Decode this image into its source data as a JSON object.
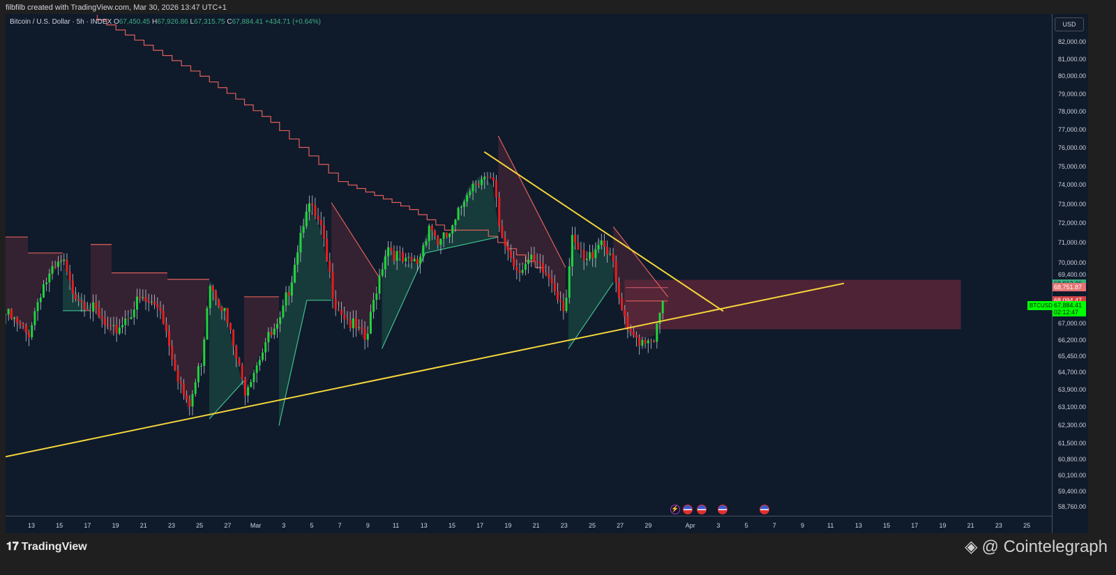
{
  "header": {
    "credit": "filbfilb created with TradingView.com, Mar 30, 2026 13:47 UTC+1"
  },
  "legend": {
    "symbol": "Bitcoin / U.S. Dollar · 5h · INDEX",
    "o_label": "O",
    "o": "67,450.45",
    "h_label": "H",
    "h": "67,926.86",
    "l_label": "L",
    "l": "67,315.75",
    "c_label": "C",
    "c": "67,884.41",
    "change": "+434.71 (+0.64%)"
  },
  "price_axis": {
    "currency": "USD",
    "ticks": [
      "82,000.00",
      "81,000.00",
      "80,000.00",
      "79,000.00",
      "78,000.00",
      "77,000.00",
      "76,000.00",
      "75,000.00",
      "74,000.00",
      "73,000.00",
      "72,000.00",
      "71,000.00",
      "70,000.00",
      "69,400.00",
      "67,000.00",
      "66,200.00",
      "65,450.00",
      "64,700.00",
      "63,900.00",
      "63,100.00",
      "62,300.00",
      "61,500.00",
      "60,800.00",
      "60,100.00",
      "59,400.00",
      "58,760.00"
    ],
    "labels": [
      {
        "text": "68,913.26",
        "value": 68913.26,
        "bg": "#3bb07f",
        "fg": "#0f1a2b"
      },
      {
        "text": "68,751.87",
        "value": 68751.87,
        "bg": "#e57373",
        "fg": "#ffffff"
      },
      {
        "text": "68,094.47",
        "value": 68094.47,
        "bg": "#cf4444",
        "fg": "#ffffff"
      }
    ],
    "last": {
      "symbol": "BTCUSD",
      "price": "67,884.41",
      "value": 67884.41,
      "countdown": "02:12:47",
      "bg": "#00ff00"
    }
  },
  "time_axis": {
    "ticks": [
      {
        "label": "13",
        "day": 0
      },
      {
        "label": "15",
        "day": 2
      },
      {
        "label": "17",
        "day": 4
      },
      {
        "label": "19",
        "day": 6
      },
      {
        "label": "21",
        "day": 8
      },
      {
        "label": "23",
        "day": 10
      },
      {
        "label": "25",
        "day": 12
      },
      {
        "label": "27",
        "day": 14
      },
      {
        "label": "Mar",
        "day": 16
      },
      {
        "label": "3",
        "day": 18
      },
      {
        "label": "5",
        "day": 20
      },
      {
        "label": "7",
        "day": 22
      },
      {
        "label": "9",
        "day": 24
      },
      {
        "label": "11",
        "day": 26
      },
      {
        "label": "13",
        "day": 28
      },
      {
        "label": "15",
        "day": 30
      },
      {
        "label": "17",
        "day": 32
      },
      {
        "label": "19",
        "day": 34
      },
      {
        "label": "21",
        "day": 36
      },
      {
        "label": "23",
        "day": 38
      },
      {
        "label": "25",
        "day": 40
      },
      {
        "label": "27",
        "day": 42
      },
      {
        "label": "29",
        "day": 44
      },
      {
        "label": "Apr",
        "day": 47
      },
      {
        "label": "3",
        "day": 49
      },
      {
        "label": "5",
        "day": 51
      },
      {
        "label": "7",
        "day": 53
      },
      {
        "label": "9",
        "day": 55
      },
      {
        "label": "11",
        "day": 57
      },
      {
        "label": "13",
        "day": 59
      },
      {
        "label": "15",
        "day": 61
      },
      {
        "label": "17",
        "day": 63
      },
      {
        "label": "19",
        "day": 65
      },
      {
        "label": "21",
        "day": 67
      },
      {
        "label": "23",
        "day": 69
      },
      {
        "label": "25",
        "day": 71
      }
    ]
  },
  "events": [
    {
      "icon": "flash-icon",
      "day": 45.9,
      "glyph": "⚡"
    },
    {
      "icon": "us-flag-icon",
      "day": 46.8
    },
    {
      "icon": "us-flag-icon",
      "day": 47.8
    },
    {
      "icon": "us-flag-icon",
      "day": 49.3
    },
    {
      "icon": "us-flag-icon",
      "day": 52.3
    }
  ],
  "footer": {
    "brand": "TradingView",
    "watermark": "@ Cointelegraph"
  },
  "colors": {
    "up": "#22d43a",
    "down": "#e61e1e",
    "bg": "#0f1a2b",
    "trendline": "#f5d63a",
    "supertrend_up": "#3fc28f",
    "supertrend_down": "#e0605a",
    "zone": "#7a2a3e"
  },
  "chart_data": {
    "type": "candlestick",
    "title": "Bitcoin / U.S. Dollar · 5h · INDEX",
    "x_unit": "days since Feb 13, 2026",
    "ylim": [
      58400,
      83600
    ],
    "y_scale": "log",
    "price_path": [
      [
        -1.8,
        67450
      ],
      [
        -0.25,
        66430
      ],
      [
        0.75,
        68820
      ],
      [
        2.24,
        70040
      ],
      [
        2.74,
        68820
      ],
      [
        4.23,
        67790
      ],
      [
        5.72,
        66430
      ],
      [
        7.71,
        68130
      ],
      [
        9.2,
        67790
      ],
      [
        10.2,
        65170
      ],
      [
        11.19,
        62880
      ],
      [
        12.19,
        65480
      ],
      [
        12.69,
        69160
      ],
      [
        13.68,
        67790
      ],
      [
        15.17,
        63870
      ],
      [
        16.67,
        66110
      ],
      [
        17.66,
        66770
      ],
      [
        18.41,
        68820
      ],
      [
        19.65,
        73070
      ],
      [
        20.65,
        71640
      ],
      [
        21.14,
        69750
      ],
      [
        21.64,
        68130
      ],
      [
        22.64,
        67100
      ],
      [
        23.88,
        66110
      ],
      [
        24.63,
        68820
      ],
      [
        25.37,
        70910
      ],
      [
        26.62,
        69890
      ],
      [
        27.61,
        70040
      ],
      [
        28.36,
        72000
      ],
      [
        29.1,
        70910
      ],
      [
        30.1,
        71640
      ],
      [
        31.09,
        73820
      ],
      [
        32.09,
        74540
      ],
      [
        33.08,
        73820
      ],
      [
        33.33,
        71640
      ],
      [
        34.58,
        69750
      ],
      [
        35.57,
        70040
      ],
      [
        37.06,
        69160
      ],
      [
        38.06,
        67790
      ],
      [
        38.56,
        71000
      ],
      [
        39.55,
        69890
      ],
      [
        40.55,
        71290
      ],
      [
        41.29,
        70480
      ],
      [
        41.79,
        68470
      ],
      [
        42.54,
        66430
      ],
      [
        43.53,
        66270
      ],
      [
        44.53,
        66430
      ],
      [
        45.02,
        67884
      ]
    ],
    "supertrend": [
      {
        "dir": "down",
        "from": -1.84,
        "to": -0.25,
        "p0": 71290,
        "p1": 71290
      },
      {
        "dir": "down",
        "from": -0.25,
        "to": 2.24,
        "p0": 70480,
        "p1": 70480
      },
      {
        "dir": "up",
        "from": 2.24,
        "to": 4.23,
        "p0": 67620,
        "p1": 67620
      },
      {
        "dir": "down",
        "from": 4.23,
        "to": 5.72,
        "p0": 70910,
        "p1": 70910
      },
      {
        "dir": "down",
        "from": 5.72,
        "to": 9.7,
        "p0": 69480,
        "p1": 69480
      },
      {
        "dir": "down",
        "from": 9.7,
        "to": 12.69,
        "p0": 69160,
        "p1": 69160
      },
      {
        "dir": "up",
        "from": 12.69,
        "to": 15.17,
        "p0": 62570,
        "p1": 64310
      },
      {
        "dir": "down",
        "from": 15.17,
        "to": 17.66,
        "p0": 68300,
        "p1": 68300
      },
      {
        "dir": "up",
        "from": 17.66,
        "to": 19.65,
        "p0": 62270,
        "p1": 68130
      },
      {
        "dir": "up",
        "from": 19.65,
        "to": 21.4,
        "p0": 68130,
        "p1": 68130
      },
      {
        "dir": "down",
        "from": 21.4,
        "to": 24.9,
        "p0": 73070,
        "p1": 69160
      },
      {
        "dir": "up",
        "from": 25.0,
        "to": 28.1,
        "p0": 65800,
        "p1": 70480
      },
      {
        "dir": "up",
        "from": 28.1,
        "to": 33.3,
        "p0": 70480,
        "p1": 71290
      },
      {
        "dir": "down",
        "from": 33.3,
        "to": 38.1,
        "p0": 76650,
        "p1": 69750
      },
      {
        "dir": "up",
        "from": 38.3,
        "to": 41.5,
        "p0": 65800,
        "p1": 68990
      },
      {
        "dir": "down",
        "from": 41.5,
        "to": 45.4,
        "p0": 71820,
        "p1": 68300
      }
    ],
    "long_stop_line": [
      [
        4.7,
        83600
      ],
      [
        12.7,
        80000
      ],
      [
        17.7,
        77400
      ],
      [
        22.6,
        74180
      ],
      [
        27.6,
        72710
      ],
      [
        30.1,
        71640
      ],
      [
        32.6,
        71640
      ],
      [
        36.6,
        69750
      ]
    ],
    "trendlines": [
      {
        "name": "support",
        "p0": [
          -1.84,
          60900
        ],
        "p1": [
          57.96,
          68960
        ]
      },
      {
        "name": "resistance",
        "p0": [
          32.3,
          75780
        ],
        "p1": [
          49.35,
          67600
        ]
      }
    ],
    "zone": {
      "from": 42.3,
      "to": 66.3,
      "top": 69130,
      "bottom": 66730
    }
  }
}
